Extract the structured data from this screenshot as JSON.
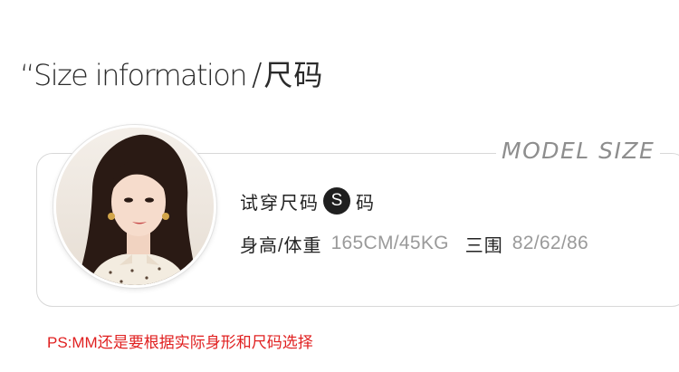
{
  "header": {
    "title_en": "“Size information",
    "title_slash": "/",
    "title_cn": "尺码"
  },
  "card": {
    "label": "MODEL SIZE",
    "avatar_alt": "model portrait",
    "fit": {
      "prefix": "试穿尺码",
      "size": "S",
      "suffix": "码"
    },
    "stats": [
      {
        "label": "身高/体重",
        "value": "165CM/45KG"
      },
      {
        "label": "三围",
        "value": "82/62/86"
      }
    ]
  },
  "note": "PS:MM还是要根据实际身形和尺码选择",
  "colors": {
    "note": "#e02020",
    "badge_bg": "#1f1f1f",
    "muted_value": "#9a9a9a",
    "card_border": "#d8d8d8"
  }
}
